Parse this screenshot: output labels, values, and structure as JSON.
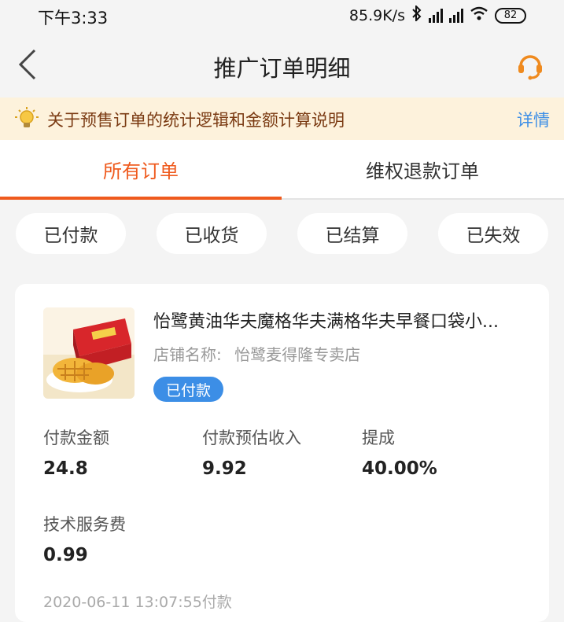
{
  "status_bar": {
    "time": "下午3:33",
    "network_speed": "85.9K/s",
    "battery": "82",
    "icons": [
      "bluetooth-icon",
      "hd-signal-icon",
      "signal-icon",
      "wifi-icon",
      "battery-icon"
    ]
  },
  "nav": {
    "title": "推广订单明细",
    "back_icon": "chevron-left-icon",
    "service_icon": "headset-icon",
    "accent_color": "#ef8a1e"
  },
  "notice": {
    "icon": "lightbulb-icon",
    "text": "关于预售订单的统计逻辑和金额计算说明",
    "link": "详情"
  },
  "tabs": [
    {
      "label": "所有订单",
      "active": true
    },
    {
      "label": "维权退款订单",
      "active": false
    }
  ],
  "filters": [
    {
      "label": "已付款"
    },
    {
      "label": "已收货"
    },
    {
      "label": "已结算"
    },
    {
      "label": "已失效"
    }
  ],
  "order": {
    "title": "怡鹭黄油华夫魔格华夫满格华夫早餐口袋小...",
    "shop_label": "店铺名称:",
    "shop_name": "怡鹭麦得隆专卖店",
    "status": "已付款",
    "metrics": [
      {
        "label": "付款金额",
        "value": "24.8"
      },
      {
        "label": "付款预估收入",
        "value": "9.92"
      },
      {
        "label": "提成",
        "value": "40.00%"
      },
      {
        "label": "技术服务费",
        "value": "0.99"
      }
    ],
    "timestamp": "2020-06-11 13:07:55付款"
  },
  "colors": {
    "accent_orange": "#ef5a1d",
    "link_blue": "#3c8ee6",
    "notice_bg": "#fdf2dc"
  }
}
